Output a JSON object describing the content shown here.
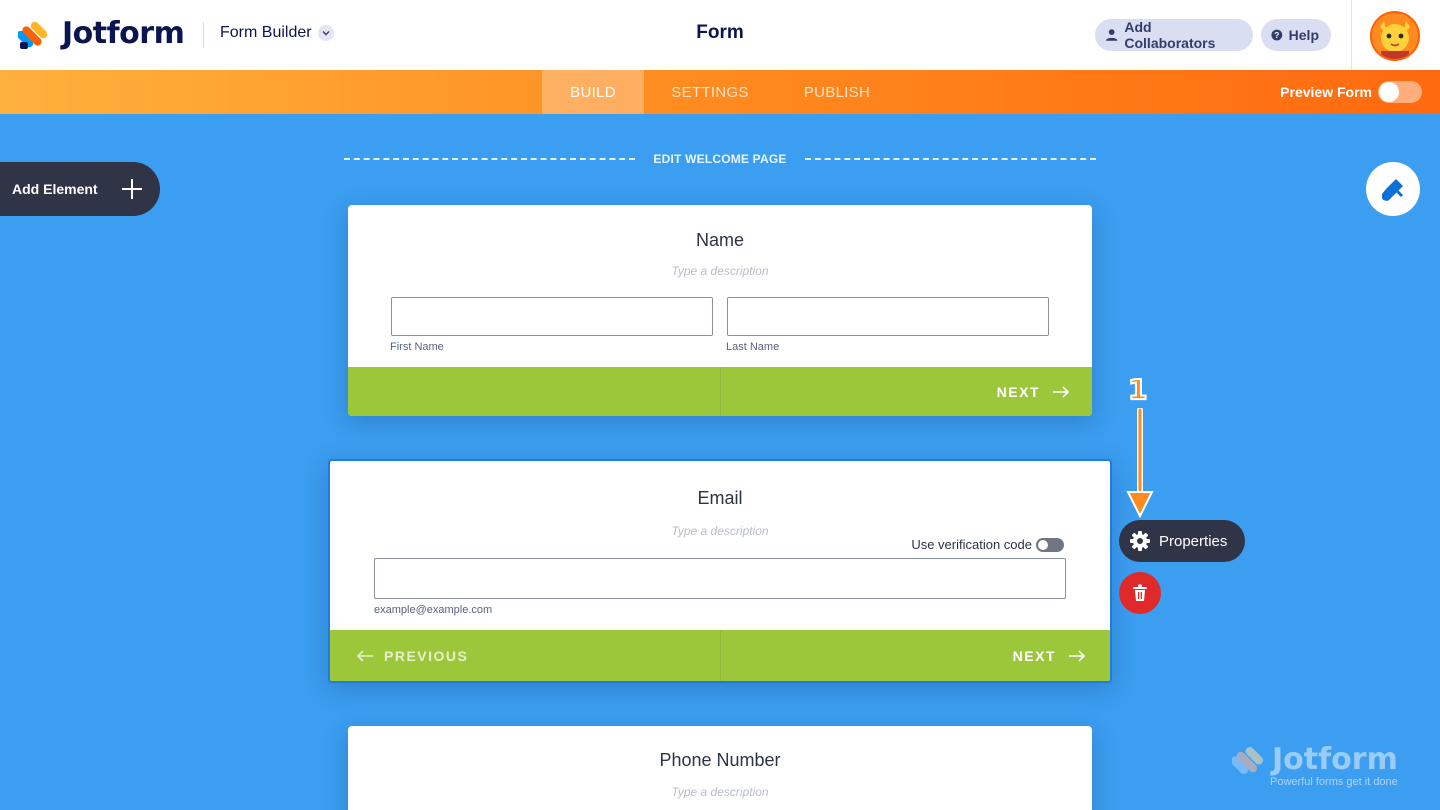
{
  "header": {
    "brand": "Jotform",
    "builder_label": "Form Builder",
    "form_title": "Form",
    "add_collaborators": "Add Collaborators",
    "help": "Help"
  },
  "nav": {
    "tabs": [
      {
        "label": "BUILD",
        "active": true
      },
      {
        "label": "SETTINGS",
        "active": false
      },
      {
        "label": "PUBLISH",
        "active": false
      }
    ],
    "preview_label": "Preview Form",
    "preview_on": false
  },
  "sidebar": {
    "add_element": "Add Element"
  },
  "welcome": {
    "label": "EDIT WELCOME PAGE"
  },
  "cards": {
    "name": {
      "title": "Name",
      "description_placeholder": "Type a description",
      "first_label": "First Name",
      "last_label": "Last Name",
      "next": "NEXT"
    },
    "email": {
      "title": "Email",
      "description_placeholder": "Type a description",
      "verification_label": "Use verification code",
      "verification_on": false,
      "sub_label": "example@example.com",
      "previous": "PREVIOUS",
      "next": "NEXT"
    },
    "phone": {
      "title": "Phone Number",
      "description_placeholder": "Type a description"
    }
  },
  "actions": {
    "properties": "Properties"
  },
  "annotation": {
    "step_number": "1"
  },
  "watermark": {
    "brand": "Jotform",
    "tagline": "Powerful forms get it done"
  },
  "colors": {
    "background": "#3b9ef1",
    "footer_green": "#9dc73b",
    "accent_orange": "#ff6100",
    "header_navy": "#0a1551",
    "dark_panel": "#2f3447",
    "delete_red": "#e02a2a"
  },
  "icons": [
    "jotform-logo-icon",
    "chevron-down-icon",
    "user-icon",
    "help-icon",
    "avatar-icon",
    "plus-icon",
    "paint-brush-icon",
    "arrow-right-icon",
    "arrow-left-icon",
    "gear-icon",
    "trash-icon",
    "arrow-down-icon"
  ]
}
